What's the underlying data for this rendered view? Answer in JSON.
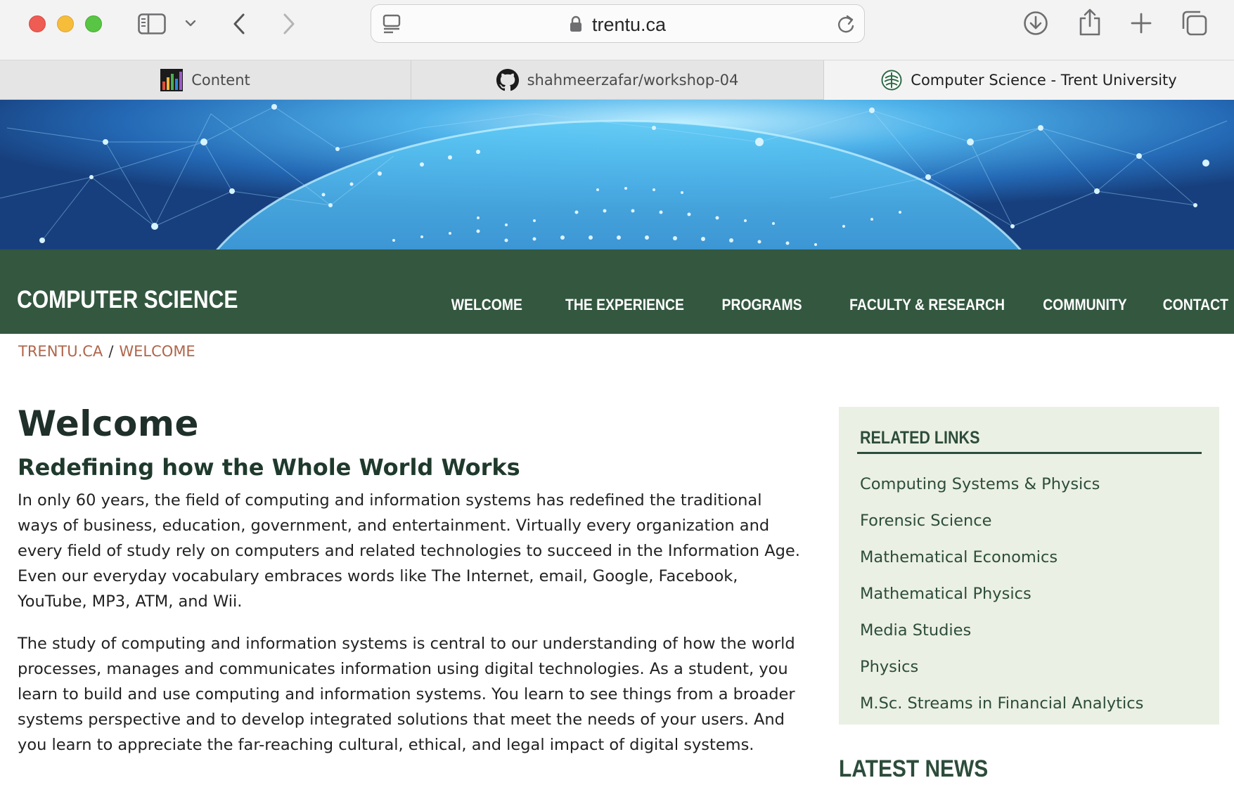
{
  "browser": {
    "url": "trentu.ca",
    "icons": {
      "sidebar": "sidebar-toggle-icon",
      "chevron": "chevron-down-icon",
      "back": "back-arrow-icon",
      "forward": "forward-arrow-icon",
      "site_info": "page-menu-icon",
      "lock": "lock-icon",
      "reload": "reload-icon",
      "download": "download-icon",
      "share": "share-icon",
      "new_tab": "plus-icon",
      "tabs": "tab-overview-icon"
    }
  },
  "tabs": [
    {
      "label": "Content",
      "icon": "bar-chart-favicon"
    },
    {
      "label": "shahmeerzafar/workshop-04",
      "icon": "github-favicon"
    },
    {
      "label": "Computer Science - Trent University",
      "icon": "trent-favicon",
      "active": true
    }
  ],
  "site": {
    "title": "COMPUTER SCIENCE",
    "nav": [
      "WELCOME",
      "THE EXPERIENCE",
      "PROGRAMS",
      "FACULTY & RESEARCH",
      "COMMUNITY",
      "CONTACT"
    ],
    "breadcrumb": {
      "home": "TRENTU.CA",
      "separator": "/",
      "current": "WELCOME"
    },
    "colors": {
      "green": "#33573f",
      "breadcrumb": "#b0654a",
      "aside_bg": "#eaf0e3"
    }
  },
  "main": {
    "heading": "Welcome",
    "subheading": "Redefining how the Whole World Works",
    "paragraphs": [
      "In only 60 years, the field of computing and information systems has redefined the traditional ways of business, education, government, and entertainment.  Virtually every organization and every field of study rely on computers and related technologies to succeed in the Information Age.  Even our everyday vocabulary embraces words like The Internet, email, Google, Facebook, YouTube, MP3, ATM, and Wii.",
      "The study of computing and information systems is central to our understanding of how the world processes, manages and communicates information using digital technologies.  As a student, you learn to build and use computing and information systems.  You learn to see things from a broader systems perspective and to develop integrated solutions that meet the needs of your users.  And you learn to appreciate the far-reaching cultural, ethical, and legal impact of digital systems."
    ]
  },
  "aside": {
    "title": "RELATED LINKS",
    "links": [
      "Computing Systems & Physics",
      "Forensic Science",
      "Mathematical Economics",
      "Mathematical Physics",
      "Media Studies",
      "Physics",
      "M.Sc. Streams in Financial Analytics"
    ]
  },
  "news": {
    "title": "LATEST NEWS"
  }
}
